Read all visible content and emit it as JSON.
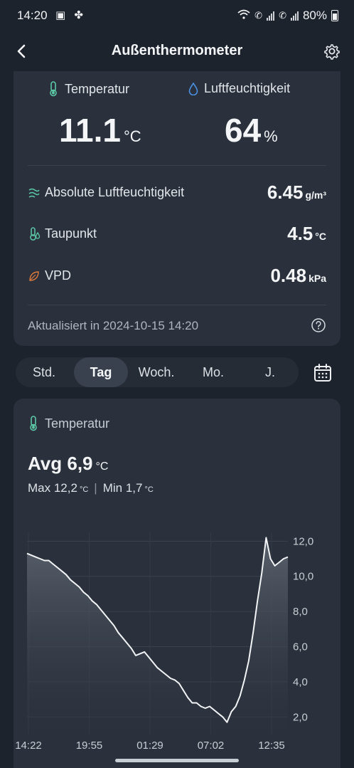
{
  "status_bar": {
    "time": "14:20",
    "battery": "80%"
  },
  "app_bar": {
    "title": "Außenthermometer"
  },
  "current": {
    "temperature": {
      "label": "Temperatur",
      "value": "11.1",
      "unit": "°C"
    },
    "humidity": {
      "label": "Luftfeuchtigkeit",
      "value": "64",
      "unit": "%"
    },
    "rows": [
      {
        "label": "Absolute Luftfeuchtigkeit",
        "value": "6.45",
        "unit": "g/m³"
      },
      {
        "label": "Taupunkt",
        "value": "4.5",
        "unit": "°C"
      },
      {
        "label": "VPD",
        "value": "0.48",
        "unit": "kPa"
      }
    ],
    "updated": "Aktualisiert in 2024-10-15 14:20"
  },
  "tabs": [
    "Std.",
    "Tag",
    "Woch.",
    "Mo.",
    "J."
  ],
  "active_tab": "Tag",
  "chart_card": {
    "label": "Temperatur",
    "avg_label": "Avg 6,9",
    "max_label": "Max 12,2",
    "min_label": "Min 1,7",
    "unit": "°C"
  },
  "colors": {
    "background": "#1d232d",
    "card": "#2a313c",
    "temp_icon": "#5cc9a7",
    "humidity_icon": "#4a90e2",
    "vpd_icon": "#e07a3a",
    "line": "#f2f4f6"
  },
  "chart_data": {
    "type": "area",
    "title": "",
    "xlabel": "",
    "ylabel": "",
    "x_tick_labels": [
      "14:22",
      "19:55",
      "01:29",
      "07:02",
      "12:35"
    ],
    "y_ticks": [
      "2,0",
      "4,0",
      "6,0",
      "8,0",
      "10,0",
      "12,0"
    ],
    "ylim": [
      1.0,
      12.5
    ],
    "y_axis_position": "right",
    "grid": true,
    "series": [
      {
        "values": [
          11.3,
          11.2,
          11.1,
          11.0,
          10.9,
          10.9,
          10.7,
          10.5,
          10.3,
          10.1,
          9.8,
          9.6,
          9.4,
          9.1,
          8.9,
          8.6,
          8.4,
          8.1,
          7.8,
          7.5,
          7.2,
          6.8,
          6.5,
          6.2,
          5.9,
          5.5,
          5.6,
          5.7,
          5.4,
          5.1,
          4.8,
          4.6,
          4.4,
          4.2,
          4.1,
          3.9,
          3.5,
          3.1,
          2.8,
          2.8,
          2.6,
          2.5,
          2.6,
          2.4,
          2.2,
          2.0,
          1.7,
          2.3,
          2.6,
          3.2,
          4.1,
          5.2,
          6.8,
          8.6,
          10.2,
          12.2,
          11.0,
          10.6,
          10.8,
          11.0,
          11.1
        ]
      }
    ]
  }
}
